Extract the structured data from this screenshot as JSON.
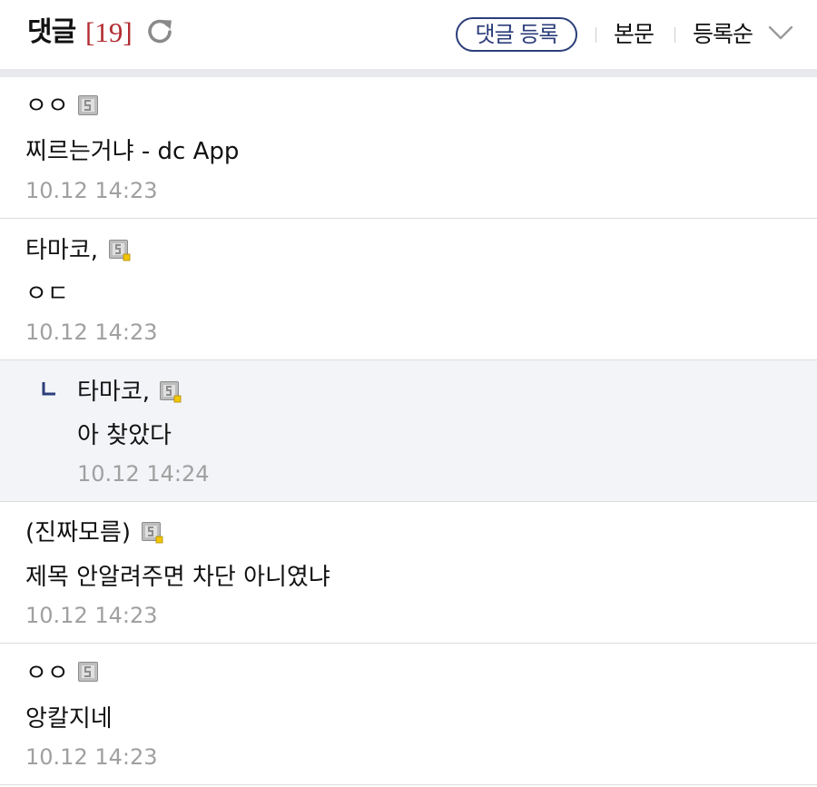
{
  "header": {
    "title": "댓글",
    "count": "[19]",
    "write_button": "댓글 등록",
    "body_link": "본문",
    "sort_label": "등록순",
    "accent_color": "#b22d33",
    "button_color": "#2c3e7a"
  },
  "comments": [
    {
      "author": "ㅇㅇ",
      "badge": "fixed-nick-icon",
      "text": "찌르는거냐 - dc App",
      "date": "10.12 14:23",
      "is_reply": false
    },
    {
      "author": "타마코,",
      "badge": "gallog-nick-icon",
      "text": "ㅇㄷ",
      "date": "10.12 14:23",
      "is_reply": false
    },
    {
      "author": "타마코,",
      "badge": "gallog-nick-icon",
      "text": "아 찾았다",
      "date": "10.12 14:24",
      "is_reply": true
    },
    {
      "author": "(진짜모름)",
      "badge": "gallog-nick-icon",
      "text": "제목 안알려주면 차단 아니였냐",
      "date": "10.12 14:23",
      "is_reply": false
    },
    {
      "author": "ㅇㅇ",
      "badge": "fixed-nick-icon",
      "text": "앙칼지네",
      "date": "10.12 14:23",
      "is_reply": false
    }
  ]
}
